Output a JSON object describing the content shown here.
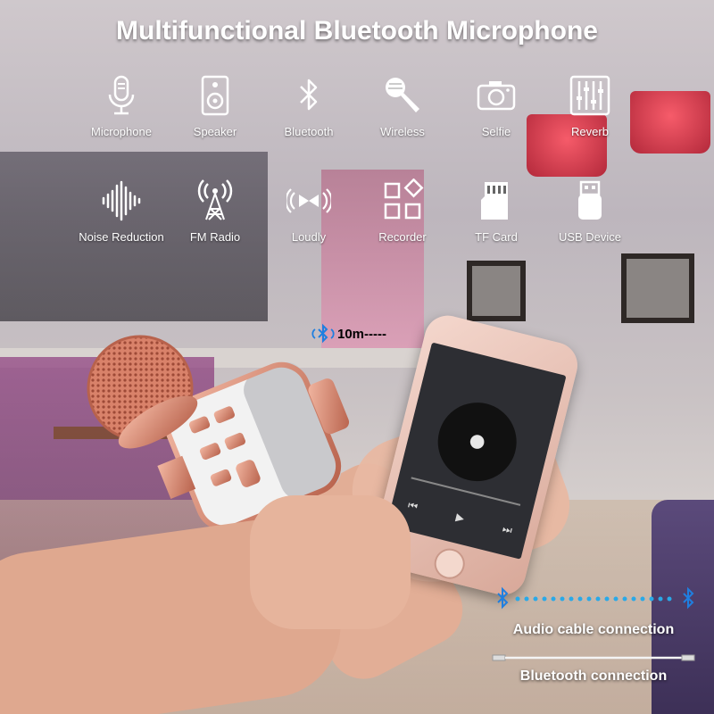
{
  "header": {
    "title": "Multifunctional Bluetooth Microphone"
  },
  "features": [
    {
      "label": "Microphone",
      "icon": "microphone-icon"
    },
    {
      "label": "Speaker",
      "icon": "speaker-icon"
    },
    {
      "label": "Bluetooth",
      "icon": "bluetooth-icon"
    },
    {
      "label": "Wireless",
      "icon": "wireless-mic-icon"
    },
    {
      "label": "Selfie",
      "icon": "camera-icon"
    },
    {
      "label": "Reverb",
      "icon": "equalizer-icon"
    },
    {
      "label": "Noise Reduction",
      "icon": "soundwave-icon"
    },
    {
      "label": "FM Radio",
      "icon": "radio-tower-icon"
    },
    {
      "label": "Loudly",
      "icon": "loudly-icon"
    },
    {
      "label": "Recorder",
      "icon": "recorder-icon"
    },
    {
      "label": "TF Card",
      "icon": "sd-card-icon"
    },
    {
      "label": "USB Device",
      "icon": "usb-icon"
    }
  ],
  "range": {
    "text": "10m-----"
  },
  "connections": {
    "audio_cable": "Audio cable connection",
    "bluetooth": "Bluetooth connection"
  },
  "colors": {
    "mic_rose_gold": "#d98a74",
    "bluetooth_blue": "#1f7fe0",
    "dot_cyan": "#29a9e8"
  }
}
